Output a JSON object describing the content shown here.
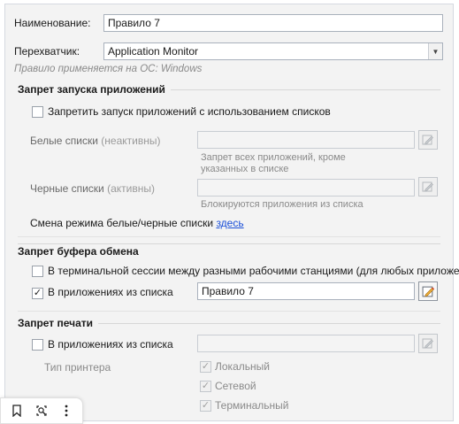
{
  "form": {
    "name_label": "Наименование:",
    "name_value": "Правило 7",
    "interceptor_label": "Перехватчик:",
    "interceptor_value": "Application Monitor",
    "os_note": "Правило применяется на ОС:  Windows"
  },
  "app_block": {
    "title": "Запрет запуска приложений",
    "use_lists_checkbox": "Запретить запуск приложений с использованием списков",
    "use_lists_checked": false,
    "whitelist_label": "Белые списки",
    "whitelist_state": "(неактивны)",
    "whitelist_hint_1": "Запрет всех приложений, кроме",
    "whitelist_hint_2": "указанных в списке",
    "blacklist_label": "Черные списки",
    "blacklist_state": "(активны)",
    "blacklist_hint": "Блокируются приложения из списка",
    "mode_switch_text": "Смена режима белые/черные списки",
    "mode_switch_link": "здесь"
  },
  "clipboard_block": {
    "title": "Запрет буфера обмена",
    "terminal_checkbox": "В терминальной сессии между разными рабочими станциями (для любых приложений)",
    "terminal_checked": false,
    "apps_checkbox": "В приложениях из списка",
    "apps_checked": true,
    "apps_value": "Правило 7"
  },
  "print_block": {
    "title": "Запрет печати",
    "apps_checkbox": "В приложениях из списка",
    "apps_checked": false,
    "printer_type_label": "Тип принтера",
    "printer_types": [
      "Локальный",
      "Сетевой",
      "Терминальный"
    ]
  },
  "toolbar": {
    "icons": [
      "bookmark-icon",
      "lens-search-icon",
      "more-vertical-icon"
    ]
  },
  "colors": {
    "accent_link": "#1a4fd8",
    "panel_bg": "#f3f3f3"
  }
}
